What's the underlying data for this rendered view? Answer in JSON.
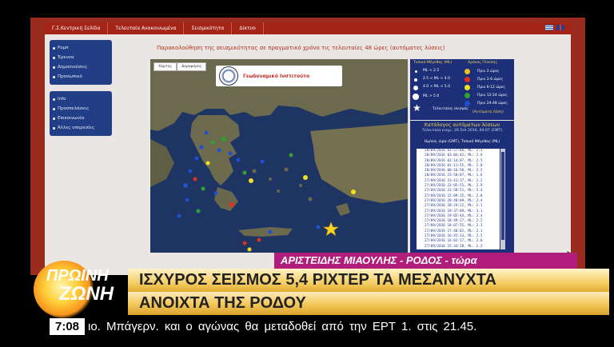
{
  "website": {
    "nav": [
      "Γ.Σ.Κεντρική Σελίδα",
      "Τελευταία Ανακοινωμένα",
      "Σεισμικότητα",
      "Δίκτυο"
    ],
    "sidebar_group1": [
      "Ρομπ",
      "Έρευνα",
      "Δημοσιεύσεις",
      "Προσωπικό"
    ],
    "sidebar_group2": [
      "Info",
      "Προσπελάσεις",
      "Επικοινωνία",
      "Άλλες υπηρεσίες"
    ],
    "page_title": "Παρακολούθηση της σεισμικότητας σε πραγματικό χρόνο τις τελευταίες 48 ώρες (αυτόματες λύσεις)",
    "map_tabs": [
      "Χάρτης",
      "Δορυφόρος"
    ],
    "logo_text": "Γεωδυναμικό Ινστιτούτο",
    "legend": {
      "magnitude_title": "Τοπικό Μέγεθος (ML)",
      "time_title": "Χρόνος Γένεσης",
      "magnitude_rows": [
        "ML < 2.5",
        "2.5 < ML < 4.0",
        "4.0 < ML < 5.0",
        "ML > 5.0",
        "Τελευταίος σεισμός"
      ],
      "time_rows": [
        {
          "label": "Πριν 2 ώρες",
          "color": "#f0c020"
        },
        {
          "label": "Πριν 2-6 ώρες",
          "color": "#e03020"
        },
        {
          "label": "Πριν 6-12 ώρες",
          "color": "#f0e020"
        },
        {
          "label": "Πριν 12-24 ώρες",
          "color": "#30a030"
        },
        {
          "label": "Πριν 24-48 ώρες",
          "color": "#2050d0"
        },
        {
          "label": "(Αυτόματη Λύση)",
          "color": "#1c2f78"
        }
      ]
    },
    "catalog": {
      "title": "Κατάλογος αυτόματων λύσεων",
      "updated": "Τελευταία ενημ.: 29 Σεπ 2016, 04:07 (GMT)",
      "columns": "Ημ/νία, ώρα (GMT), Τοπικό Μέγεθος (ML)",
      "rows": [
        "28/09/2016 03:57:06, ML: 2.3",
        "28/09/2016 03:04:42, ML: 2.6",
        "28/09/2016 01:14:07, ML: 2.5",
        "28/09/2016 01:11:55, ML: 2.0",
        "28/09/2016 00:16:50, ML: 2.2",
        "28/09/2016 23:58:07, ML: 1.6",
        "27/09/2016 23:41:37, ML: 2.2",
        "27/09/2016 23:05:55, ML: 2.9",
        "27/09/2016 22:58:51, ML: 5.4",
        "27/09/2016 22:09:15, ML: 2.0",
        "27/09/2016 20:48:09, ML: 2.4",
        "27/09/2016 20:24:22, ML: 2.1",
        "27/09/2016 19:37:09, ML: 3.1",
        "27/09/2016 19:05:44, ML: 2.4",
        "27/09/2016 18:49:27, ML: 2.2",
        "27/09/2016 18:07:55, ML: 2.3",
        "27/09/2016 17:40:01, ML: 2.1",
        "27/09/2016 16:45:33, ML: 2.5",
        "27/09/2016 16:02:17, ML: 2.0",
        "27/09/2016 15:34:58, ML: 2.2"
      ]
    }
  },
  "broadcast": {
    "show_logo_line1": "ΠΡΩΙΝΗ",
    "show_logo_line2": "ΖΩΝΗ",
    "reporter_bar": "ΑΡΙΣΤΕΙΔΗΣ ΜΙΑΟΥΛΗΣ - ΡΟΔΟΣ - τώρα",
    "headline_line1": "ΙΣΧΥΡΟΣ ΣΕΙΣΜΟΣ 5,4 ΡΙΧΤΕΡ ΤΑ ΜΕΣΑΝΥΧΤΑ",
    "headline_line2": "ΑΝΟΙΧΤΑ ΤΗΣ ΡΟΔΟΥ",
    "clock": "7:08",
    "ticker": "ιο. Μπάγερν. και ο αγώνας θα μεταδοθεί από την ΕΡΤ 1. στις 21.45.",
    "colors": {
      "reporter_bar": "#b01d7b",
      "headline": "#f6d26e",
      "nav": "#a52418"
    }
  }
}
